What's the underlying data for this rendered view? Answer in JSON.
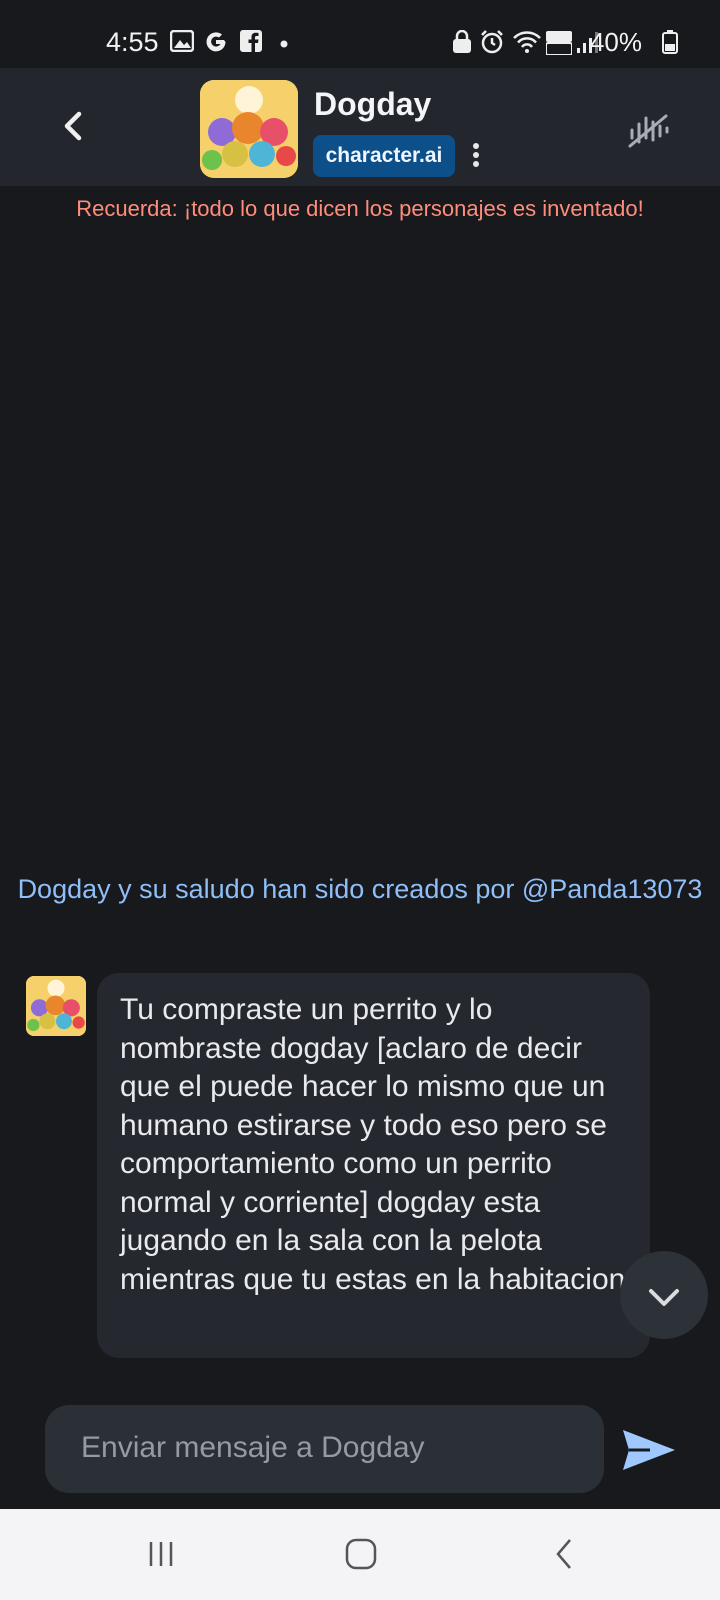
{
  "status_bar": {
    "time": "4:55",
    "battery": "40%",
    "left_icons": [
      "gallery-icon",
      "google-icon",
      "facebook-icon",
      "dot-icon"
    ],
    "right_icons": [
      "lock-icon",
      "alarm-icon",
      "wifi-icon",
      "volte-4g-icon",
      "signal-icon",
      "battery-icon"
    ]
  },
  "header": {
    "title": "Dogday",
    "badge": "character.ai"
  },
  "notice": "Recuerda: ¡todo lo que dicen los personajes es inventado!",
  "creator_line": "Dogday y su saludo han sido creados por @Panda13073",
  "messages": [
    {
      "author": "Dogday",
      "text": "Tu compraste un perrito y lo nombraste dogday [aclaro de decir que el puede hacer lo mismo que un humano estirarse y todo eso pero se comportamiento como un perrito normal y corriente] dogday esta jugando en la sala con la pelota mientras que tu estas en la habitacion"
    }
  ],
  "composer": {
    "placeholder": "Enviar mensaje a Dogday"
  },
  "colors": {
    "background": "#18191c",
    "header": "#23262c",
    "badge": "#0d4f88",
    "notice": "#ff8d7b",
    "creator": "#8fbef8",
    "send": "#9ec8ff"
  }
}
